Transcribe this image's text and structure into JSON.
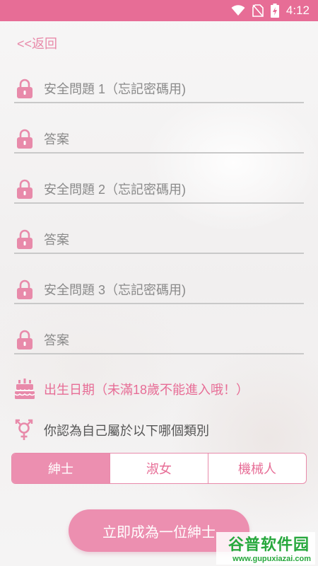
{
  "status_bar": {
    "time": "4:12"
  },
  "back_label": "<<返回",
  "fields": [
    {
      "label": "安全問題 1（忘記密碼用)"
    },
    {
      "label": "答案"
    },
    {
      "label": "安全問題 2（忘記密碼用)"
    },
    {
      "label": "答案"
    },
    {
      "label": "安全問題 3（忘記密碼用)"
    },
    {
      "label": "答案"
    }
  ],
  "birth_date_label": "出生日期（未滿18歲不能進入哦！）",
  "gender_question": "你認為自己屬於以下哪個類別",
  "gender_options": [
    {
      "label": "紳士",
      "selected": true
    },
    {
      "label": "淑女",
      "selected": false
    },
    {
      "label": "機械人",
      "selected": false
    }
  ],
  "submit_label": "立即成為一位紳士",
  "watermark": {
    "logo": "谷普软件园",
    "url": "www.gupuxiazai.com"
  },
  "colors": {
    "accent": "#e76d96",
    "accent_light": "#ec8fb0"
  }
}
